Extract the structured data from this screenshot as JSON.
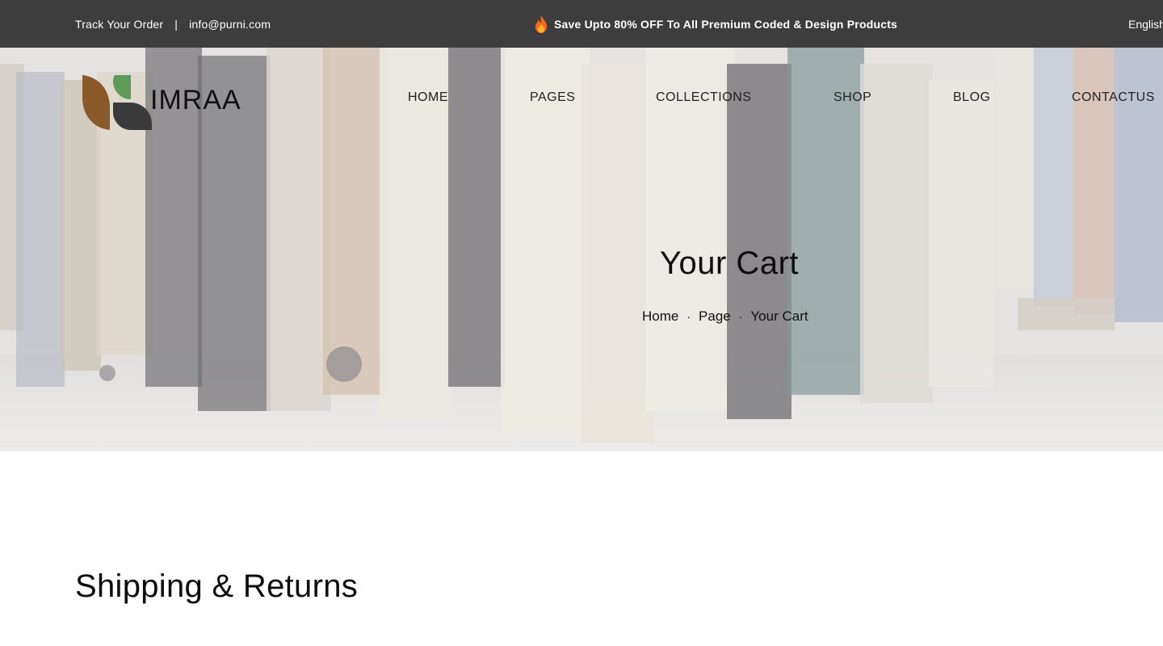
{
  "topbar": {
    "track_label": "Track Your Order",
    "separator": "|",
    "email": "info@purni.com",
    "promo_icon": "flame-icon",
    "promo_text": "Save Upto 80% OFF To All Premium Coded & Design Products",
    "language": "English"
  },
  "brand": {
    "name": "IMRAA",
    "colors": {
      "leaf_brown": "#8a5a2b",
      "leaf_green": "#5e9a58",
      "leaf_dark": "#3a3a3a",
      "topbar_bg": "#3d3d3d"
    }
  },
  "nav": {
    "items": [
      {
        "label": "HOME"
      },
      {
        "label": "PAGES"
      },
      {
        "label": "COLLECTIONS"
      },
      {
        "label": "SHOP"
      },
      {
        "label": "BLOG"
      },
      {
        "label": "CONTACTUS"
      }
    ]
  },
  "hero": {
    "title": "Your Cart",
    "breadcrumb": [
      {
        "label": "Home"
      },
      {
        "label": "Page"
      },
      {
        "label": "Your Cart"
      }
    ],
    "separator": "·"
  },
  "section": {
    "title": "Shipping & Returns"
  }
}
